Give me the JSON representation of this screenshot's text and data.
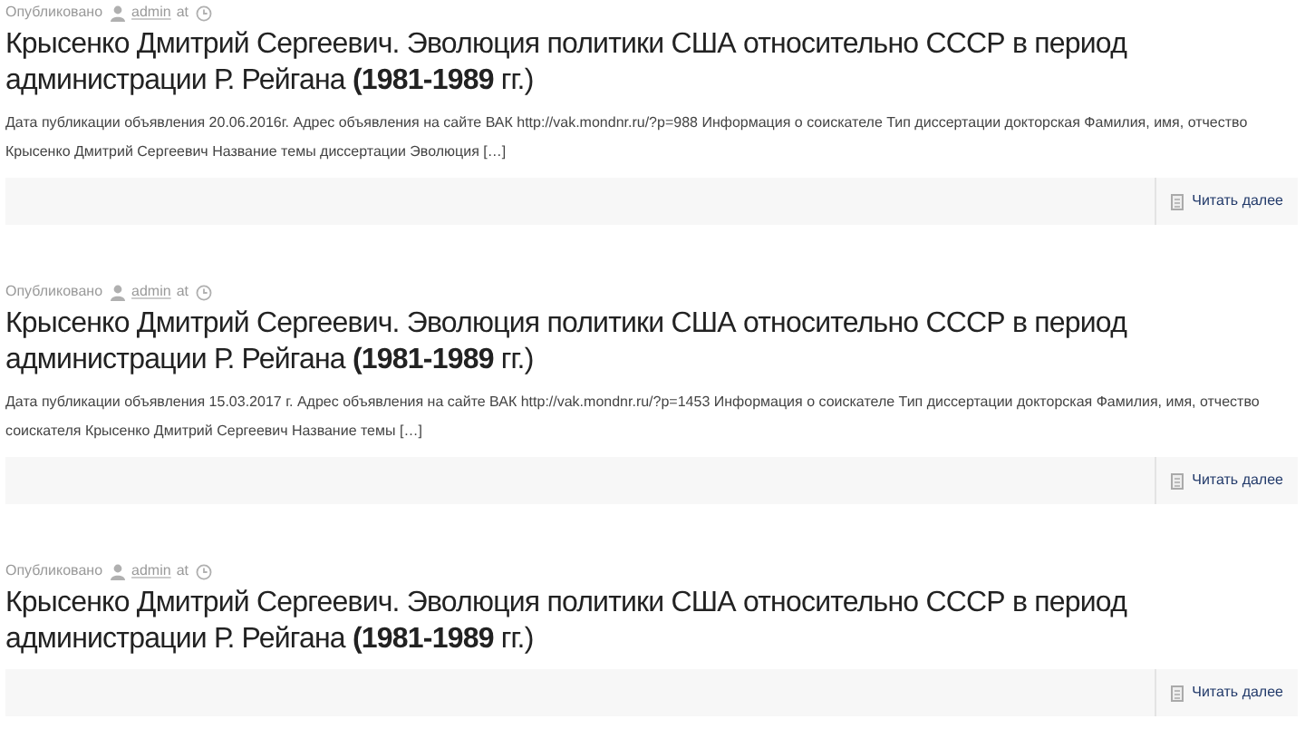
{
  "posts": [
    {
      "meta": {
        "published_label": "Опубликовано",
        "author": "admin",
        "at": "at"
      },
      "title": "Крысенко Дмитрий Сергеевич. Эволюция политики США относительно СССР в период администрации Р. Рейгана **(1981-1989** гг.)",
      "excerpt": "Дата публикации объявления 20.06.2016г. Адрес объявления на сайте ВАК http://vak.mondnr.ru/?p=988 Информация о соискателе Тип диссертации докторская Фамилия, имя, отчество Крысенко Дмитрий Сергеевич Название темы диссертации Эволюция […]",
      "read_more": "Читать далее"
    },
    {
      "meta": {
        "published_label": "Опубликовано",
        "author": "admin",
        "at": "at"
      },
      "title": "Крысенко Дмитрий Сергеевич. Эволюция политики США относительно СССР в период администрации Р. Рейгана **(1981-1989** гг.)",
      "excerpt": "Дата публикации объявления 15.03.2017 г. Адрес объявления на сайте ВАК http://vak.mondnr.ru/?p=1453 Информация о соискателе Тип диссертации докторская Фамилия, имя, отчество соискателя Крысенко Дмитрий Сергеевич Название темы […]",
      "read_more": "Читать далее"
    },
    {
      "meta": {
        "published_label": "Опубликовано",
        "author": "admin",
        "at": "at"
      },
      "title": "Крысенко Дмитрий Сергеевич. Эволюция политики США относительно СССР в период администрации Р. Рейгана **(1981-1989** гг.)",
      "read_more": "Читать далее"
    }
  ]
}
